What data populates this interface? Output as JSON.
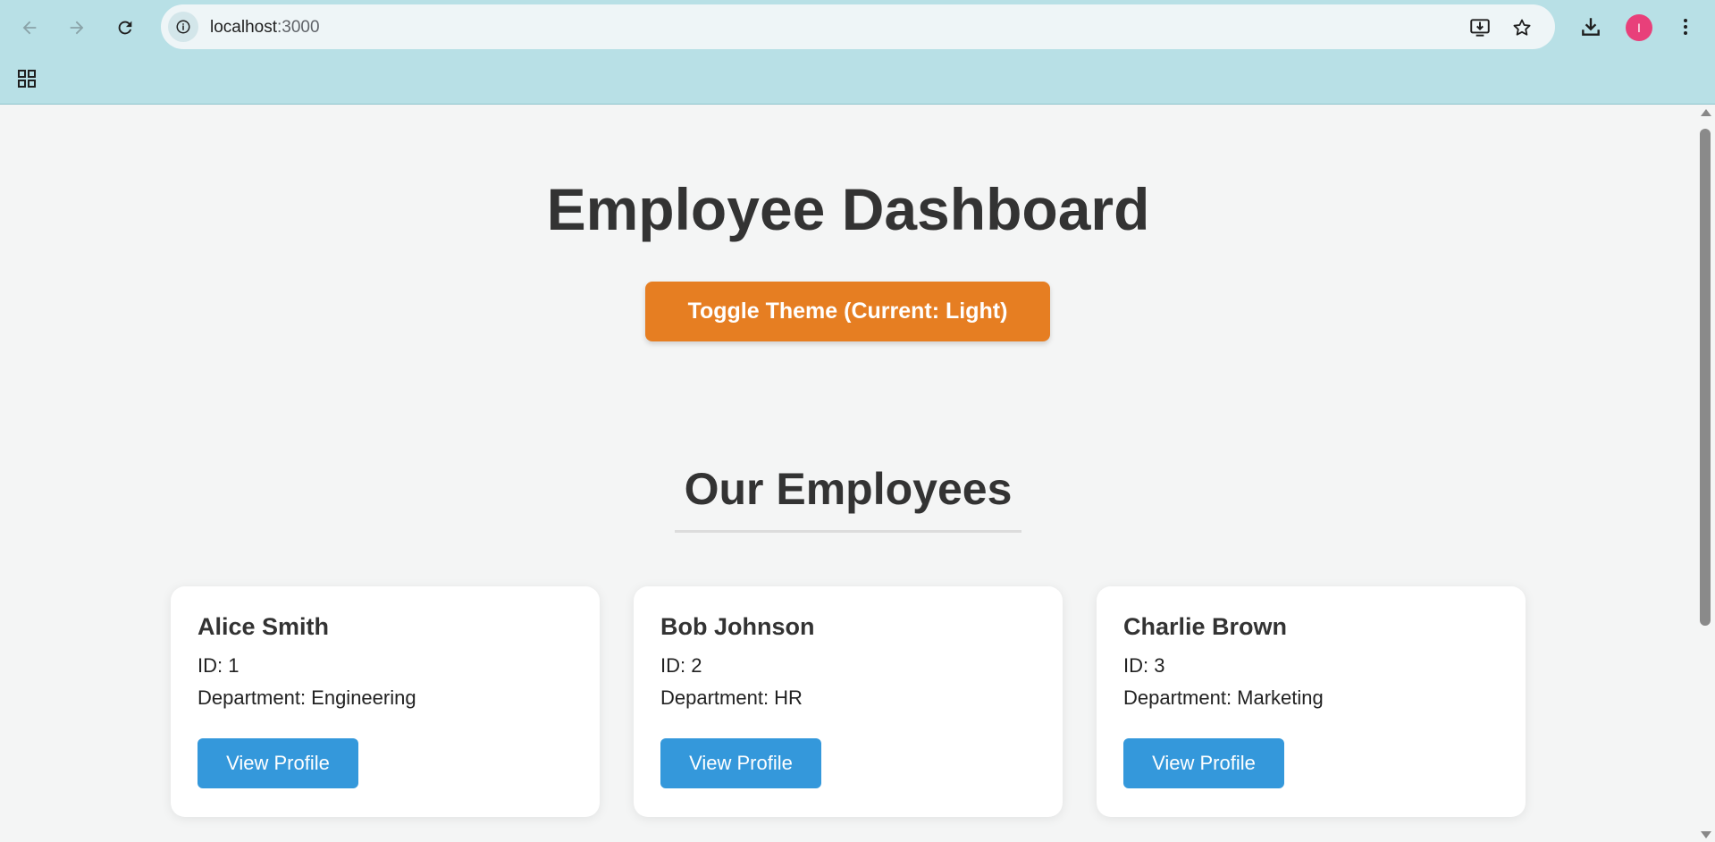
{
  "browser": {
    "url_host": "localhost",
    "url_port": ":3000",
    "avatar_initial": "I",
    "icons": {
      "back": "back-arrow-icon",
      "forward": "forward-arrow-icon",
      "reload": "reload-icon",
      "site_info": "info-icon",
      "install": "install-app-icon",
      "bookmark": "star-icon",
      "downloads": "download-icon",
      "menu": "kebab-menu-icon",
      "apps": "apps-grid-icon"
    }
  },
  "page": {
    "title": "Employee Dashboard",
    "theme_button_label": "Toggle Theme (Current: Light)",
    "section_title": "Our Employees",
    "employees": [
      {
        "name": "Alice Smith",
        "id_text": "ID: 1",
        "department_text": "Department: Engineering",
        "button_label": "View Profile"
      },
      {
        "name": "Bob Johnson",
        "id_text": "ID: 2",
        "department_text": "Department: HR",
        "button_label": "View Profile"
      },
      {
        "name": "Charlie Brown",
        "id_text": "ID: 3",
        "department_text": "Department: Marketing",
        "button_label": "View Profile"
      }
    ]
  },
  "colors": {
    "accent_orange": "#e67e22",
    "button_blue": "#3498db",
    "chrome_bg": "#b8e0e6",
    "avatar_pink": "#e8407a"
  }
}
